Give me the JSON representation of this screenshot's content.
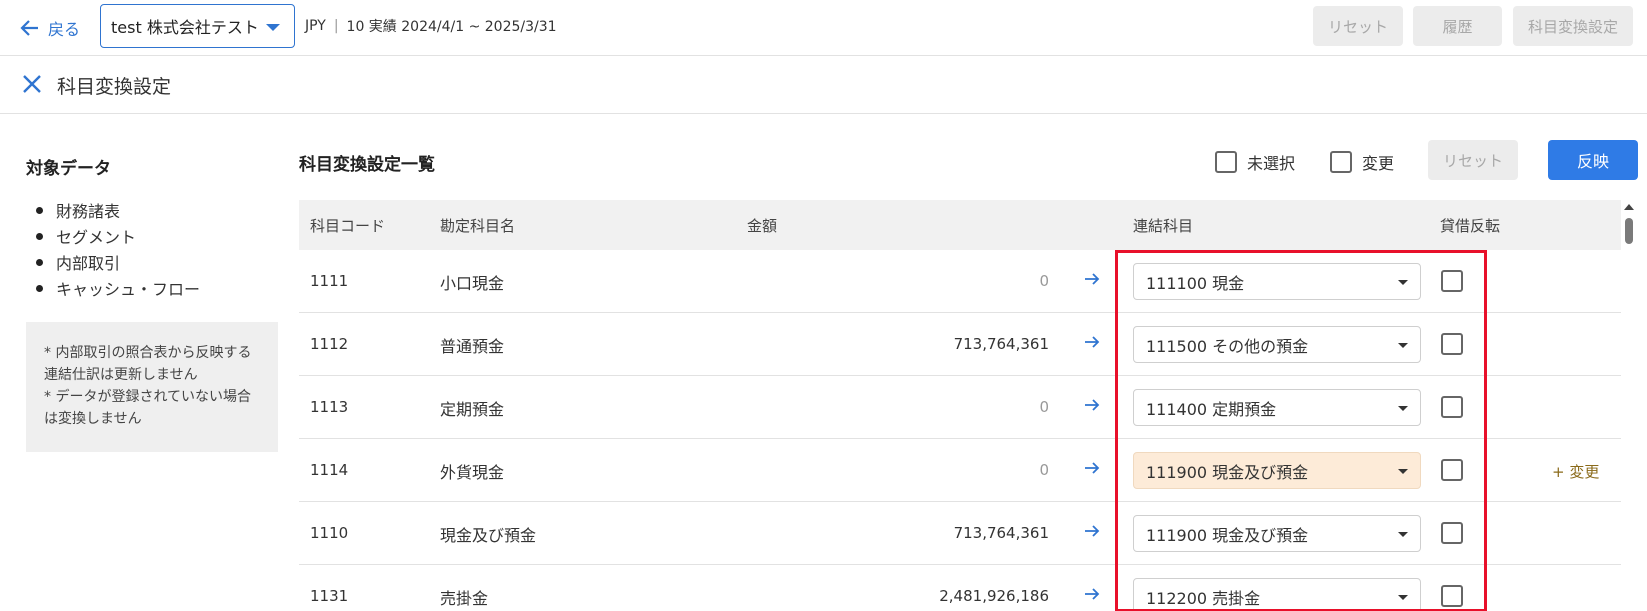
{
  "topbar": {
    "back_label": "戻る",
    "company": "test 株式会社テスト",
    "currency": "JPY",
    "separator": "|",
    "period": "10 実績 2024/4/1 ~ 2025/3/31",
    "buttons": [
      "リセット",
      "履歴",
      "科目変換設定"
    ]
  },
  "header": {
    "title": "科目変換設定"
  },
  "sidebar": {
    "title": "対象データ",
    "items": [
      "財務諸表",
      "セグメント",
      "内部取引",
      "キャッシュ・フロー"
    ],
    "notes": [
      "* 内部取引の照合表から反映する連結仕訳は更新しません",
      "* データが登録されていない場合は変換しません"
    ]
  },
  "main": {
    "title": "科目変換設定一覧",
    "filters": [
      "未選択",
      "変更"
    ],
    "reset_label": "リセット",
    "apply_label": "反映",
    "columns": [
      "科目コード",
      "勘定科目名",
      "金額",
      "連結科目",
      "貸借反転"
    ],
    "rows": [
      {
        "code": "1111",
        "name": "小口現金",
        "amount": "0",
        "consolidated": "111100 現金",
        "change": ""
      },
      {
        "code": "1112",
        "name": "普通預金",
        "amount": "713,764,361",
        "consolidated": "111500 その他の預金",
        "change": ""
      },
      {
        "code": "1113",
        "name": "定期預金",
        "amount": "0",
        "consolidated": "111400 定期預金",
        "change": ""
      },
      {
        "code": "1114",
        "name": "外貨現金",
        "amount": "0",
        "consolidated": "111900 現金及び預金",
        "change": "+ 変更"
      },
      {
        "code": "1110",
        "name": "現金及び預金",
        "amount": "713,764,361",
        "consolidated": "111900 現金及び預金",
        "change": ""
      },
      {
        "code": "1131",
        "name": "売掛金",
        "amount": "2,481,926,186",
        "consolidated": "112200 売掛金",
        "change": ""
      }
    ]
  },
  "colors": {
    "accent": "#2f7be6",
    "highlight": "#e8102a",
    "changed_bg": "#fdebd8"
  }
}
